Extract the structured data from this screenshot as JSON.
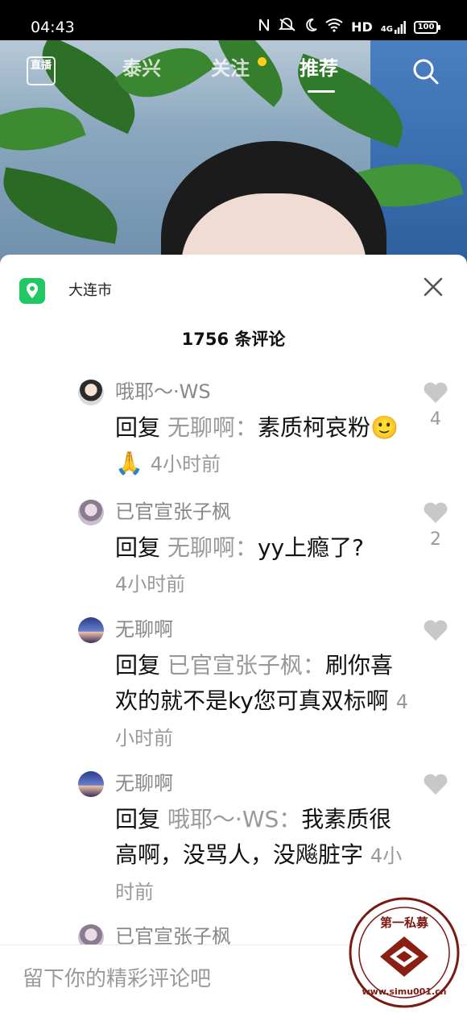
{
  "status_bar": {
    "time": "04:43",
    "icons": [
      "nfc-icon",
      "mute-icon",
      "moon-icon",
      "wifi-icon",
      "signal-icon",
      "battery-icon"
    ],
    "hd_label": "HD",
    "signal_label": "4G",
    "battery": "100"
  },
  "top_nav": {
    "live_label": "直播",
    "tabs": [
      {
        "label": "泰兴"
      },
      {
        "label": "关注"
      },
      {
        "label": "推荐"
      }
    ],
    "active_tab": "推荐",
    "dot_color": "#FFCF1A"
  },
  "comments_panel": {
    "location": "大连市",
    "location_icon_color": "#1FC864",
    "count_label": "1756 条评论",
    "comments": [
      {
        "user": "哦耶～·WS",
        "reply_prefix": "回复",
        "reply_to": "无聊啊：",
        "text": "素质柯哀粉",
        "emoji": "🙂🙏",
        "time": "4小时前",
        "likes": "4"
      },
      {
        "user": "已官宣张子枫",
        "reply_prefix": "回复",
        "reply_to": "无聊啊：",
        "text": "yy上瘾了?",
        "time": "4小时前",
        "likes": "2"
      },
      {
        "user": "无聊啊",
        "reply_prefix": "回复",
        "reply_to": "已官宣张子枫：",
        "text": "刷你喜欢的就不是ky您可真双标啊",
        "time": "4小时前",
        "likes": ""
      },
      {
        "user": "无聊啊",
        "reply_prefix": "回复",
        "reply_to": "哦耶～·WS：",
        "text": "我素质很高啊，没骂人，没飚脏字",
        "time": "4小时前",
        "likes": ""
      },
      {
        "user": "已官宣张子枫"
      }
    ]
  },
  "input": {
    "placeholder": "留下你的精彩评论吧"
  },
  "watermark": {
    "top_text": "第一私募",
    "bottom_text": "www.simu001.cn"
  }
}
